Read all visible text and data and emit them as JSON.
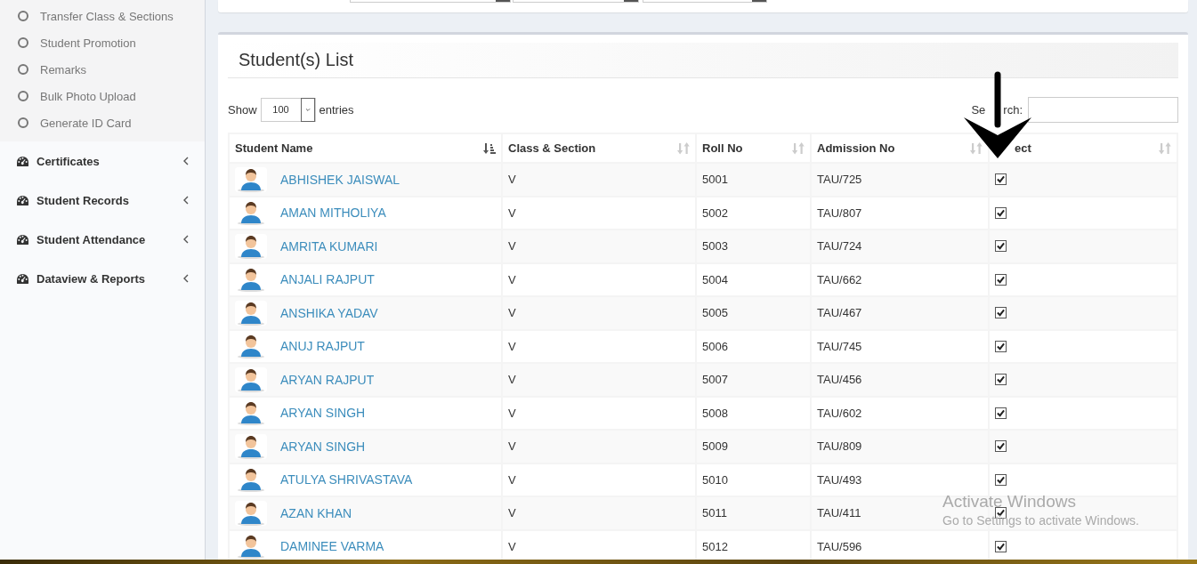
{
  "sidebar": {
    "submenu": [
      {
        "label": "Transfer Class & Sections"
      },
      {
        "label": "Student Promotion"
      },
      {
        "label": "Remarks"
      },
      {
        "label": "Bulk Photo Upload"
      },
      {
        "label": "Generate ID Card"
      }
    ],
    "items": [
      {
        "label": "Certificates",
        "expanded": false
      },
      {
        "label": "Student Records",
        "expanded": false
      },
      {
        "label": "Student Attendance",
        "expanded": false
      },
      {
        "label": "Dataview & Reports",
        "expanded": false
      }
    ]
  },
  "panel": {
    "title": "Student(s) List",
    "show_label": "Show",
    "page_size": "100",
    "entries_label": "entries",
    "search_label": [
      "Se",
      "rch:"
    ]
  },
  "table": {
    "columns": [
      {
        "label": "Student Name",
        "sorted": true
      },
      {
        "label": "Class & Section",
        "sorted": false
      },
      {
        "label": "Roll No",
        "sorted": false
      },
      {
        "label": "Admission No",
        "sorted": false
      },
      {
        "label": "ect",
        "sorted": false
      }
    ],
    "rows": [
      {
        "name": "ABHISHEK JAISWAL",
        "class": "V",
        "roll": "5001",
        "admission": "TAU/725",
        "checked": true
      },
      {
        "name": "AMAN MITHOLIYA",
        "class": "V",
        "roll": "5002",
        "admission": "TAU/807",
        "checked": true
      },
      {
        "name": "AMRITA KUMARI",
        "class": "V",
        "roll": "5003",
        "admission": "TAU/724",
        "checked": true
      },
      {
        "name": "ANJALI RAJPUT",
        "class": "V",
        "roll": "5004",
        "admission": "TAU/662",
        "checked": true
      },
      {
        "name": "ANSHIKA YADAV",
        "class": "V",
        "roll": "5005",
        "admission": "TAU/467",
        "checked": true
      },
      {
        "name": "ANUJ RAJPUT",
        "class": "V",
        "roll": "5006",
        "admission": "TAU/745",
        "checked": true
      },
      {
        "name": "ARYAN RAJPUT",
        "class": "V",
        "roll": "5007",
        "admission": "TAU/456",
        "checked": true
      },
      {
        "name": "ARYAN SINGH",
        "class": "V",
        "roll": "5008",
        "admission": "TAU/602",
        "checked": true
      },
      {
        "name": "ARYAN SINGH",
        "class": "V",
        "roll": "5009",
        "admission": "TAU/809",
        "checked": true
      },
      {
        "name": "ATULYA SHRIVASTAVA",
        "class": "V",
        "roll": "5010",
        "admission": "TAU/493",
        "checked": true
      },
      {
        "name": "AZAN KHAN",
        "class": "V",
        "roll": "5011",
        "admission": "TAU/411",
        "checked": true
      },
      {
        "name": "DAMINEE VARMA",
        "class": "V",
        "roll": "5012",
        "admission": "TAU/596",
        "checked": true
      }
    ]
  },
  "os_notice": {
    "title": "Activate Windows",
    "message": "Go to Settings to activate Windows."
  }
}
